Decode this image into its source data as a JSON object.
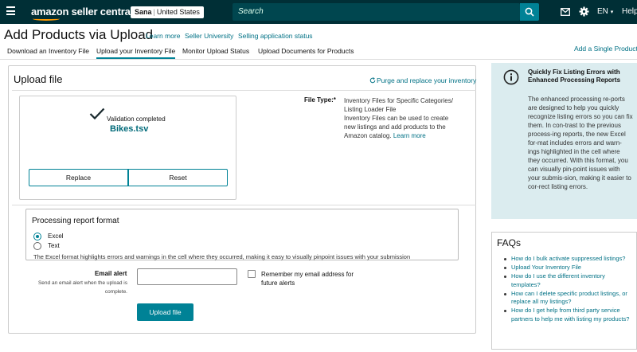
{
  "header": {
    "logo": "amazon seller central",
    "store_name": "Sana",
    "store_region": "United States",
    "search_placeholder": "Search",
    "language": "EN",
    "help": "Help"
  },
  "page": {
    "title": "Add Products via Upload",
    "links": [
      "Learn more",
      "University",
      "Selling application status"
    ],
    "add_single": "Add a Single Product"
  },
  "tabs": [
    {
      "label": "Download an Inventory File",
      "active": false
    },
    {
      "label": "Upload your Inventory File",
      "active": true
    },
    {
      "label": "Monitor Upload Status",
      "active": false
    },
    {
      "label": "Upload Documents for Products",
      "active": false
    }
  ],
  "upload": {
    "title": "Upload file",
    "purge_link": "Purge and replace your inventory",
    "validation_status": "Validation completed",
    "file_name": "Bikes.tsv",
    "replace_label": "Replace",
    "reset_label": "Reset",
    "file_type_label": "File Type:*",
    "file_type_name": "Inventory Files for Specific Categories/ Listing Loader File",
    "file_type_help": "Inventory Files can be used to create new listings and add products to the Amazon catalog.",
    "learn_more": "Learn more"
  },
  "processing_report": {
    "title": "Processing report format",
    "options": [
      {
        "label": "Excel",
        "selected": true
      },
      {
        "label": "Text",
        "selected": false
      }
    ],
    "description": "The Excel format highlights errors and warnings in the cell where they occurred, making it easy to visually pinpoint issues with your submission"
  },
  "email": {
    "label": "Email alert",
    "help": "Send an email alert when the upload is complete.",
    "value": "",
    "remember_label": "Remember my email address for future alerts",
    "remember_checked": false
  },
  "submit_label": "Upload file",
  "info_box": {
    "title": "Quickly Fix Listing Errors with Enhanced Processing Reports",
    "body": "The enhanced processing re-ports are designed to help you quickly recognize listing errors so you can fix them. In con-trast to the previous process-ing reports, the new Excel for-mat includes errors and warn-ings highlighted in the cell where they occurred. With this format, you can visually pin-point issues with your submis-sion, making it easier to cor-rect listing errors."
  },
  "faqs": {
    "title": "FAQs",
    "items": [
      "How do I bulk activate suppressed listings?",
      "Upload Your Inventory File",
      "How do I use the different inventory templates?",
      "How can I delete specific product listings, or replace all my listings?",
      "How do I get help from third party service partners to help me with listing my products?"
    ]
  },
  "colors": {
    "topbar": "#002f36",
    "accent": "#008296",
    "link": "#007185",
    "info_bg": "#dbecef"
  }
}
